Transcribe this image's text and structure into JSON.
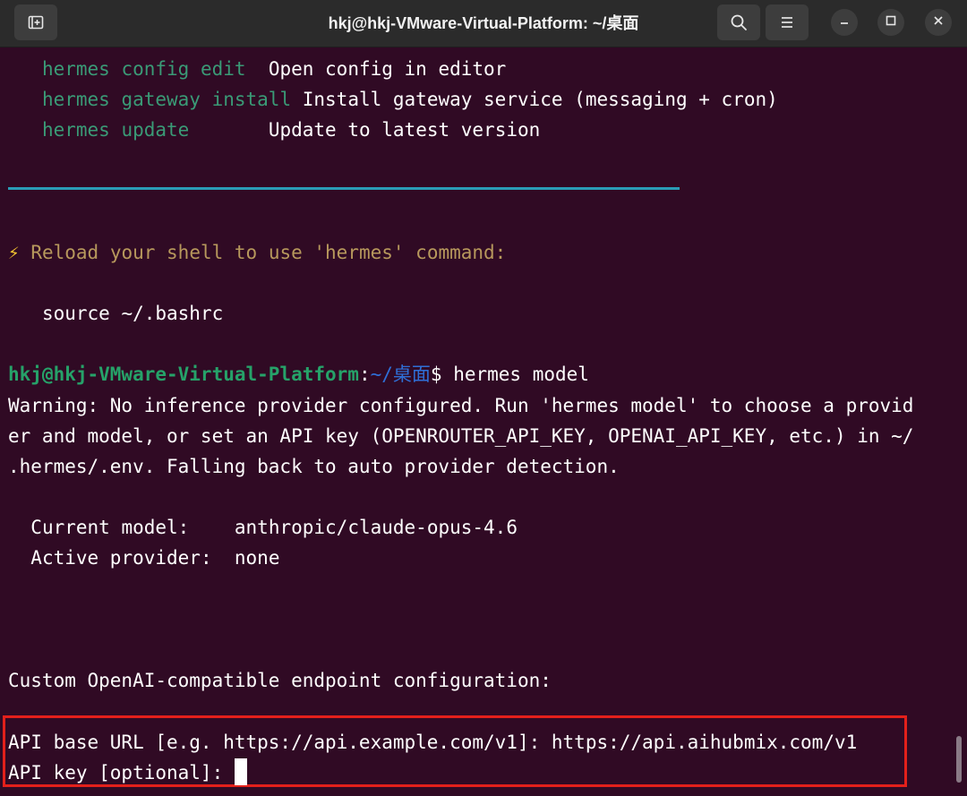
{
  "window": {
    "title": "hkj@hkj-VMware-Virtual-Platform: ~/桌面",
    "new_tab_icon": "new-tab-icon",
    "search_icon": "search-icon",
    "menu_icon": "hamburger-menu-icon",
    "minimize_icon": "minimize-icon",
    "maximize_icon": "maximize-icon",
    "close_icon": "close-icon"
  },
  "terminal": {
    "commands": [
      {
        "cmd": "hermes config edit",
        "pad": "  ",
        "desc": "Open config in editor"
      },
      {
        "cmd": "hermes gateway install",
        "pad": " ",
        "desc": "Install gateway service (messaging + cron)"
      },
      {
        "cmd": "hermes update",
        "pad": "       ",
        "desc": "Update to latest version"
      }
    ],
    "reload_icon": "⚡",
    "reload_text": "Reload your shell to use 'hermes' command:",
    "source_cmd": "source ~/.bashrc",
    "prompt": {
      "user_host": "hkj@hkj-VMware-Virtual-Platform",
      "colon": ":",
      "path": "~/桌面",
      "symbol": "$",
      "command": "hermes model"
    },
    "warning_lines": [
      "Warning: No inference provider configured. Run 'hermes model' to choose a provid",
      "er and model, or set an API key (OPENROUTER_API_KEY, OPENAI_API_KEY, etc.) in ~/",
      ".hermes/.env. Falling back to auto provider detection."
    ],
    "current_model_label": "Current model:",
    "current_model_value": "anthropic/claude-opus-4.6",
    "active_provider_label": "Active provider:",
    "active_provider_value": "none",
    "custom_endpoint_heading": "Custom OpenAI-compatible endpoint configuration:",
    "api_base_prompt": "API base URL [e.g. https://api.example.com/v1]:",
    "api_base_value": "https://api.aihubmix.com/v1",
    "api_key_prompt": "API key [optional]:",
    "api_key_value": ""
  },
  "colors": {
    "background": "#300a24",
    "command_green": "#4cae5c",
    "prompt_green": "#26a269",
    "path_blue": "#2f6fd6",
    "rule_cyan": "#2a9cb6",
    "reload_yellow": "#b7985c",
    "highlight_red": "#e3201b"
  }
}
